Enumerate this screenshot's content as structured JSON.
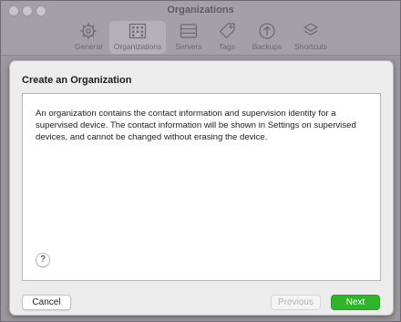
{
  "window": {
    "title": "Organizations"
  },
  "toolbar": {
    "items": [
      {
        "label": "General",
        "icon": "gear-icon"
      },
      {
        "label": "Organizations",
        "icon": "building-icon",
        "selected": true
      },
      {
        "label": "Servers",
        "icon": "server-icon"
      },
      {
        "label": "Tags",
        "icon": "tag-icon"
      },
      {
        "label": "Backups",
        "icon": "backup-icon"
      },
      {
        "label": "Shortcuts",
        "icon": "layers-icon"
      }
    ]
  },
  "sheet": {
    "title": "Create an Organization",
    "description": "An organization contains the contact information and supervision identity for a supervised device. The contact information will be shown in Settings on supervised devices, and cannot be changed without erasing the device.",
    "help_label": "?",
    "buttons": {
      "cancel": "Cancel",
      "previous": "Previous",
      "next": "Next"
    }
  },
  "colors": {
    "accent_green": "#2fb42a",
    "disabled_text": "#b3b3b5"
  }
}
